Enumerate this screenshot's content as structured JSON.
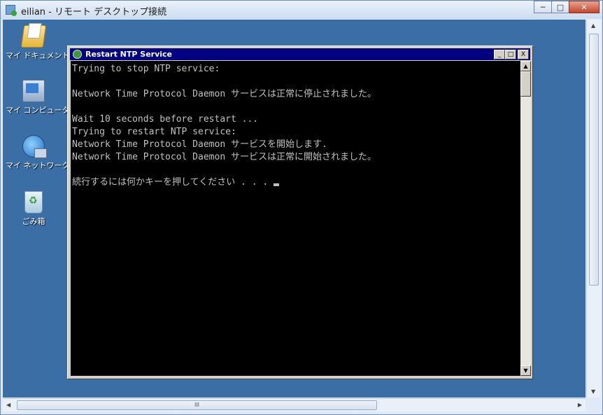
{
  "remote_window": {
    "title": "eilian - リモート デスクトップ接続",
    "minimize": "─",
    "maximize": "□",
    "close": "✕"
  },
  "desktop_icons": [
    {
      "label": "マイ ドキュメント",
      "icon": "my-documents-icon"
    },
    {
      "label": "マイ コンピュータ",
      "icon": "my-computer-icon"
    },
    {
      "label": "マイ ネットワーク",
      "icon": "my-network-icon"
    },
    {
      "label": "ごみ箱",
      "icon": "recycle-bin-icon"
    }
  ],
  "console": {
    "title": "Restart NTP Service",
    "minimize": "_",
    "maximize": "□",
    "close": "X",
    "lines": [
      "Trying to stop NTP service:",
      "",
      "Network Time Protocol Daemon サービスは正常に停止されました。",
      "",
      "Wait 10 seconds before restart ...",
      "Trying to restart NTP service:",
      "Network Time Protocol Daemon サービスを開始します.",
      "Network Time Protocol Daemon サービスは正常に開始されました。",
      "",
      "続行するには何かキーを押してください . . . "
    ]
  },
  "scrollbar": {
    "up": "▲",
    "down": "▼",
    "left": "◀",
    "right": "▶",
    "grip": "III"
  },
  "colors": {
    "desktop": "#3a6ea5",
    "console_title": "#000080",
    "console_text": "#c0c0c0"
  }
}
